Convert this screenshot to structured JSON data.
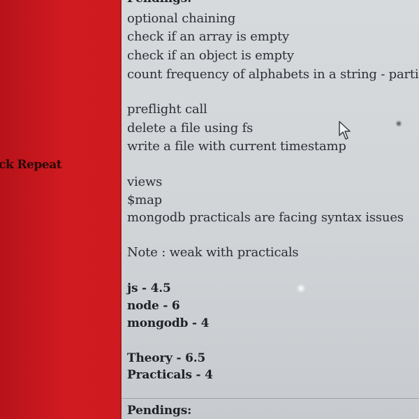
{
  "sidebar": {
    "label": "ck Repeat"
  },
  "notes": {
    "header_top": "Pendings:",
    "group1": [
      "optional chaining",
      "check if an array is empty",
      "check if an object is empty",
      "count frequency of alphabets in a string - partiall"
    ],
    "group2": [
      "preflight call",
      "delete a file using fs",
      "write a file with current timestamp"
    ],
    "group3": [
      "views",
      "$map",
      "mongodb practicals are facing syntax issues"
    ],
    "note": "Note : weak with practicals",
    "scores": [
      "js - 4.5",
      "node - 6",
      "mongodb - 4"
    ],
    "totals": [
      "Theory - 6.5",
      "Practicals - 4"
    ],
    "footer_header": "Pendings:"
  },
  "colors": {
    "panel_red": "#d01b20",
    "page_bg": "#d4d7d9",
    "text": "#2b2f35"
  },
  "icons": {
    "cursor": "mouse-pointer-icon"
  }
}
